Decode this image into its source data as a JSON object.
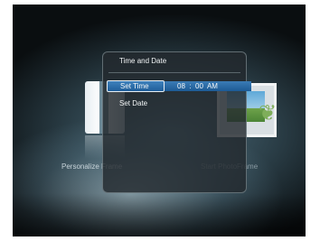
{
  "background_menu": {
    "left_label": "Personalize Frame",
    "right_label": "Start PhotoFrame",
    "left_icon": "gift-box-icon",
    "right_icon": "photo-frame-icon"
  },
  "dialog": {
    "title": "Time and Date",
    "items": [
      {
        "label": "Set Time",
        "selected": true
      },
      {
        "label": "Set Date",
        "selected": false
      }
    ],
    "time": {
      "hour": "08",
      "separator": ":",
      "minute": "00",
      "meridiem": "AM"
    }
  },
  "colors": {
    "highlight": "#2a6aa8",
    "dialog_bg": "#232a2e",
    "text": "#f3f6f7"
  }
}
